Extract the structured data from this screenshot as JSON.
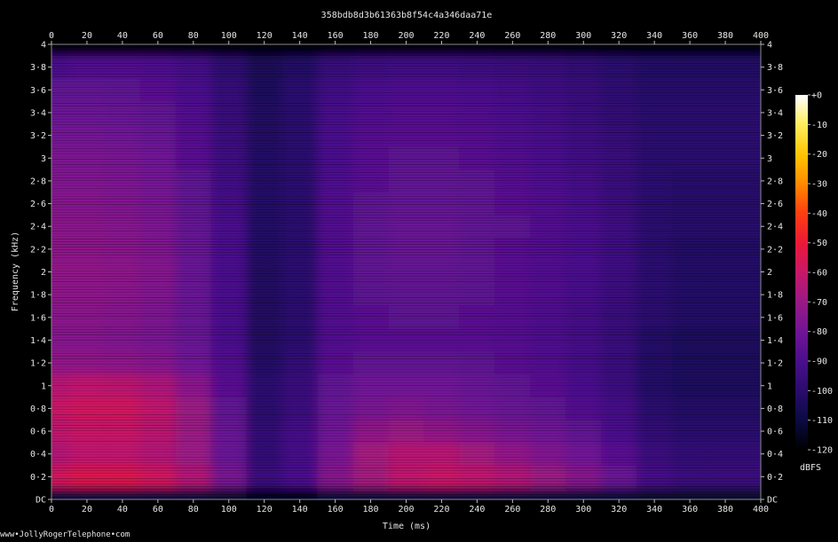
{
  "chart_data": {
    "type": "heatmap",
    "title": "358bdb8d3b61363b8f54c4a346daa71e",
    "xlabel": "Time (ms)",
    "ylabel": "Frequency (kHz)",
    "xlim": [
      0,
      400
    ],
    "ylim": [
      0,
      4
    ],
    "x_ticks": [
      "0",
      "20",
      "40",
      "60",
      "80",
      "100",
      "120",
      "140",
      "160",
      "180",
      "200",
      "220",
      "240",
      "260",
      "280",
      "300",
      "320",
      "340",
      "360",
      "380",
      "400"
    ],
    "y_ticks": [
      "DC",
      "0·2",
      "0·4",
      "0·6",
      "0·8",
      "1",
      "1·2",
      "1·4",
      "1·6",
      "1·8",
      "2",
      "2·2",
      "2·4",
      "2·6",
      "2·8",
      "3",
      "3·2",
      "3·4",
      "3·6",
      "3·8",
      "4"
    ],
    "colorbar": {
      "label": "dBFS",
      "ticks": [
        "+0",
        "-10",
        "-20",
        "-30",
        "-40",
        "-50",
        "-60",
        "-70",
        "-80",
        "-90",
        "-100",
        "-110",
        "-120"
      ],
      "range": [
        -120,
        0
      ]
    },
    "time_bins_ms": [
      0,
      20,
      40,
      60,
      80,
      100,
      120,
      140,
      160,
      180,
      200,
      220,
      240,
      260,
      280,
      300,
      320,
      340,
      360,
      380,
      400
    ],
    "freq_bins_khz": [
      0,
      0.2,
      0.4,
      0.6,
      0.8,
      1.0,
      1.2,
      1.4,
      1.6,
      1.8,
      2.0,
      2.2,
      2.4,
      2.6,
      2.8,
      3.0,
      3.2,
      3.4,
      3.6,
      3.8,
      4.0
    ],
    "level_dbfs": [
      [
        -110,
        -110,
        -110,
        -110,
        -110,
        -112,
        -115,
        -115,
        -110,
        -110,
        -110,
        -110,
        -110,
        -110,
        -110,
        -110,
        -110,
        -112,
        -112,
        -112,
        -112
      ],
      [
        -58,
        -55,
        -55,
        -58,
        -65,
        -78,
        -95,
        -90,
        -75,
        -68,
        -62,
        -60,
        -62,
        -65,
        -70,
        -75,
        -82,
        -92,
        -95,
        -95,
        -95
      ],
      [
        -65,
        -62,
        -62,
        -65,
        -70,
        -82,
        -98,
        -92,
        -78,
        -68,
        -64,
        -64,
        -68,
        -72,
        -76,
        -80,
        -86,
        -95,
        -98,
        -98,
        -98
      ],
      [
        -62,
        -60,
        -60,
        -63,
        -70,
        -82,
        -98,
        -92,
        -80,
        -72,
        -70,
        -72,
        -75,
        -78,
        -80,
        -84,
        -90,
        -98,
        -100,
        -100,
        -100
      ],
      [
        -60,
        -58,
        -58,
        -62,
        -70,
        -84,
        -100,
        -95,
        -82,
        -78,
        -76,
        -78,
        -80,
        -82,
        -84,
        -88,
        -92,
        -100,
        -102,
        -102,
        -102
      ],
      [
        -64,
        -62,
        -63,
        -66,
        -74,
        -86,
        -100,
        -96,
        -84,
        -80,
        -80,
        -80,
        -82,
        -84,
        -86,
        -90,
        -95,
        -102,
        -104,
        -104,
        -104
      ],
      [
        -72,
        -72,
        -73,
        -75,
        -80,
        -88,
        -102,
        -98,
        -86,
        -84,
        -84,
        -84,
        -85,
        -86,
        -88,
        -92,
        -96,
        -102,
        -104,
        -104,
        -104
      ],
      [
        -75,
        -75,
        -76,
        -78,
        -82,
        -90,
        -103,
        -100,
        -88,
        -86,
        -86,
        -86,
        -86,
        -87,
        -89,
        -92,
        -96,
        -102,
        -104,
        -104,
        -104
      ],
      [
        -74,
        -74,
        -75,
        -77,
        -82,
        -90,
        -103,
        -100,
        -88,
        -86,
        -85,
        -85,
        -86,
        -87,
        -89,
        -92,
        -96,
        -100,
        -102,
        -102,
        -102
      ],
      [
        -73,
        -73,
        -74,
        -76,
        -82,
        -90,
        -103,
        -100,
        -88,
        -85,
        -84,
        -84,
        -85,
        -86,
        -88,
        -91,
        -95,
        -100,
        -102,
        -102,
        -102
      ],
      [
        -72,
        -72,
        -73,
        -75,
        -82,
        -90,
        -103,
        -100,
        -88,
        -84,
        -83,
        -83,
        -84,
        -86,
        -88,
        -90,
        -94,
        -100,
        -102,
        -102,
        -102
      ],
      [
        -73,
        -73,
        -74,
        -76,
        -82,
        -90,
        -102,
        -100,
        -88,
        -84,
        -82,
        -82,
        -84,
        -86,
        -88,
        -90,
        -94,
        -100,
        -102,
        -102,
        -102
      ],
      [
        -74,
        -74,
        -75,
        -77,
        -83,
        -90,
        -102,
        -100,
        -88,
        -84,
        -82,
        -82,
        -84,
        -85,
        -88,
        -90,
        -94,
        -100,
        -101,
        -101,
        -101
      ],
      [
        -75,
        -75,
        -76,
        -78,
        -84,
        -92,
        -102,
        -100,
        -88,
        -85,
        -83,
        -83,
        -84,
        -86,
        -88,
        -91,
        -95,
        -100,
        -101,
        -101,
        -101
      ],
      [
        -76,
        -76,
        -77,
        -79,
        -85,
        -93,
        -102,
        -100,
        -89,
        -86,
        -84,
        -84,
        -85,
        -87,
        -89,
        -92,
        -96,
        -100,
        -101,
        -101,
        -101
      ],
      [
        -77,
        -77,
        -78,
        -80,
        -86,
        -94,
        -102,
        -100,
        -90,
        -86,
        -85,
        -85,
        -86,
        -88,
        -90,
        -93,
        -96,
        -100,
        -100,
        -100,
        -100
      ],
      [
        -79,
        -79,
        -80,
        -82,
        -87,
        -95,
        -103,
        -100,
        -90,
        -87,
        -86,
        -86,
        -87,
        -89,
        -91,
        -94,
        -97,
        -100,
        -100,
        -100,
        -100
      ],
      [
        -81,
        -81,
        -82,
        -84,
        -88,
        -96,
        -103,
        -100,
        -91,
        -88,
        -87,
        -87,
        -88,
        -90,
        -92,
        -95,
        -98,
        -100,
        -100,
        -100,
        -100
      ],
      [
        -84,
        -84,
        -85,
        -86,
        -90,
        -97,
        -104,
        -100,
        -93,
        -90,
        -89,
        -89,
        -90,
        -92,
        -94,
        -96,
        -99,
        -101,
        -101,
        -101,
        -101
      ],
      [
        -90,
        -88,
        -88,
        -89,
        -92,
        -99,
        -105,
        -102,
        -96,
        -94,
        -93,
        -93,
        -94,
        -95,
        -96,
        -98,
        -100,
        -102,
        -102,
        -102,
        -102
      ],
      [
        -118,
        -118,
        -118,
        -118,
        -118,
        -118,
        -118,
        -118,
        -118,
        -118,
        -118,
        -118,
        -118,
        -118,
        -118,
        -118,
        -118,
        -118,
        -118,
        -118,
        -118
      ]
    ]
  },
  "footer": {
    "text": "www•JollyRogerTelephone•com"
  }
}
